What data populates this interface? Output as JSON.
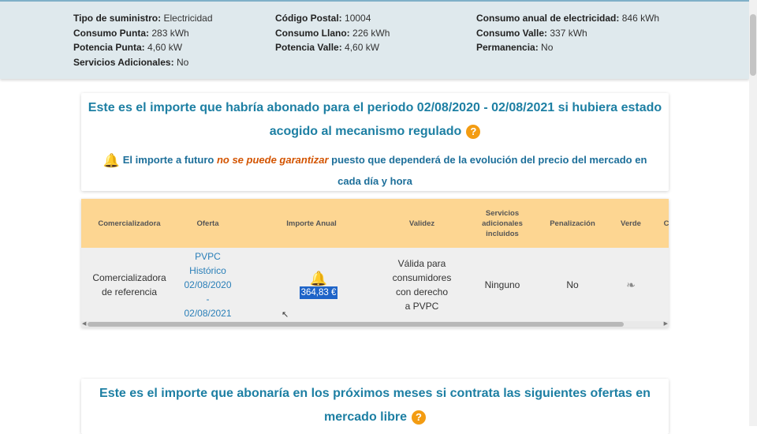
{
  "summary": {
    "col1": [
      {
        "label": "Tipo de suministro:",
        "value": "Electricidad"
      },
      {
        "label": "Consumo Punta:",
        "value": "283 kWh"
      },
      {
        "label": "Potencia Punta:",
        "value": "4,60 kW"
      },
      {
        "label": "Servicios Adicionales:",
        "value": "No"
      }
    ],
    "col2": [
      {
        "label": "Código Postal:",
        "value": "10004"
      },
      {
        "label": "Consumo Llano:",
        "value": "226 kWh"
      },
      {
        "label": "Potencia Valle:",
        "value": "4,60 kW"
      }
    ],
    "col3": [
      {
        "label": "Consumo anual de electricidad:",
        "value": "846 kWh"
      },
      {
        "label": "Consumo Valle:",
        "value": "337 kWh"
      },
      {
        "label": "Permanencia:",
        "value": "No"
      }
    ]
  },
  "regulated": {
    "title_line1": "Este es el importe que habría abonado para el periodo 02/08/2020 - 02/08/2021 si hubiera estado",
    "title_line2": "acogido al mecanismo regulado",
    "help_icon": "question-icon",
    "warning_pre": "El importe a futuro",
    "warning_em": "no se puede garantizar",
    "warning_post": "puesto que dependerá de la evolución del precio del mercado en",
    "warning_line2": "cada día y hora",
    "warning_icon": "bell-icon"
  },
  "table": {
    "headers": {
      "comercializadora": "Comercializadora",
      "oferta": "Oferta",
      "importe": "Importe Anual",
      "validez": "Validez",
      "servicios_l1": "Servicios",
      "servicios_l2": "adicionales",
      "servicios_l3": "incluidos",
      "penalizacion": "Penalización",
      "verde": "Verde",
      "extra": "C"
    },
    "row": {
      "comercializadora_l1": "Comercializadora",
      "comercializadora_l2": "de referencia",
      "oferta_l1": "PVPC",
      "oferta_l2": "Histórico",
      "oferta_l3": "02/08/2020",
      "oferta_l4": "-",
      "oferta_l5": "02/08/2021",
      "importe": "364,83 €",
      "validez_l1": "Válida para",
      "validez_l2": "consumidores",
      "validez_l3": "con derecho",
      "validez_l4": "a PVPC",
      "servicios": "Ninguno",
      "penalizacion": "No",
      "verde_icon": "leaf-icon"
    }
  },
  "free_market": {
    "title_line1": "Este es el importe que abonaría en los próximos meses si contrata las siguientes ofertas en",
    "title_line2": "mercado libre",
    "help_icon": "question-icon"
  },
  "colors": {
    "accent_blue": "#1d7fa3",
    "header_orange": "#fdd692",
    "warning_orange": "#f39c12",
    "summary_bg": "#dfe9ed"
  }
}
